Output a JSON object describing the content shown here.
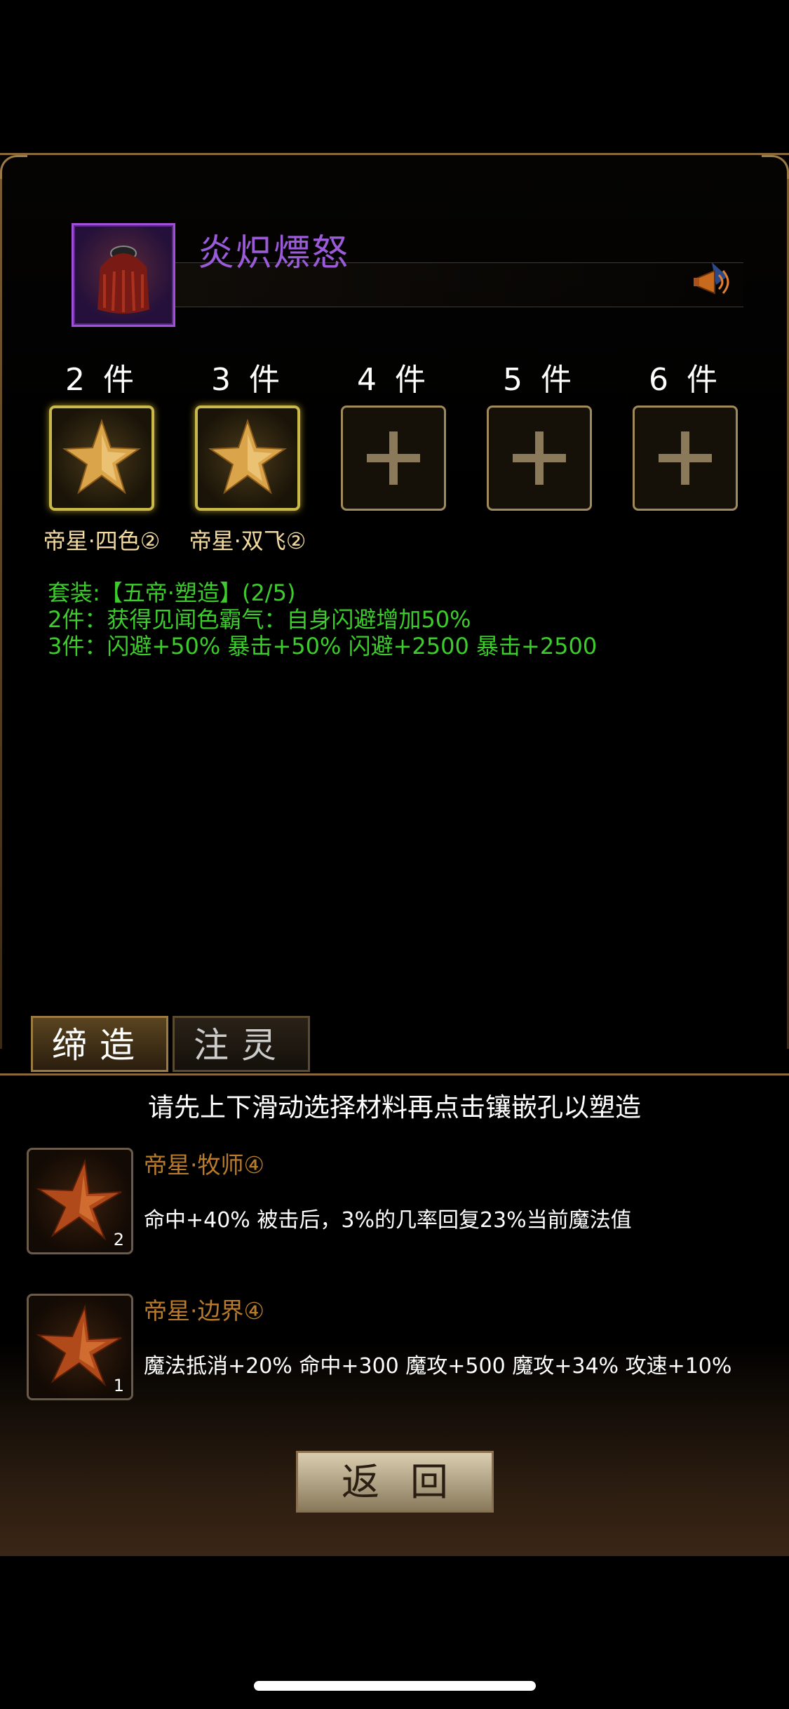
{
  "item": {
    "name": "炎炽熛怒",
    "horn_icon": "horn-icon",
    "portrait_icon": "hair-helmet-icon"
  },
  "set_slots": [
    {
      "count": "2 件",
      "filled": true,
      "label": "帝星·四色②"
    },
    {
      "count": "3 件",
      "filled": true,
      "label": "帝星·双飞②"
    },
    {
      "count": "4 件",
      "filled": false,
      "label": ""
    },
    {
      "count": "5 件",
      "filled": false,
      "label": ""
    },
    {
      "count": "6 件",
      "filled": false,
      "label": ""
    }
  ],
  "set_bonus": {
    "title": "套装:【五帝·塑造】(2/5)",
    "line2": "2件：获得见闻色霸气：自身闪避增加50%",
    "line3": "3件：闪避+50% 暴击+50% 闪避+2500 暴击+2500"
  },
  "tabs": {
    "forge": "缔造",
    "spirit": "注灵"
  },
  "hint": "请先上下滑动选择材料再点击镶嵌孔以塑造",
  "materials": [
    {
      "name": "帝星·牧师④",
      "desc": "命中+40% 被击后，3%的几率回复23%当前魔法值",
      "qty": "2"
    },
    {
      "name": "帝星·边界④",
      "desc": "魔法抵消+20% 命中+300 魔攻+500 魔攻+34% 攻速+10%",
      "qty": "1"
    }
  ],
  "back_button": "返回",
  "colors": {
    "accent_gold": "#c9b84a",
    "name_purple": "#9b5bd9",
    "bonus_green": "#3ccc2c",
    "material_orange": "#b97a2a"
  }
}
